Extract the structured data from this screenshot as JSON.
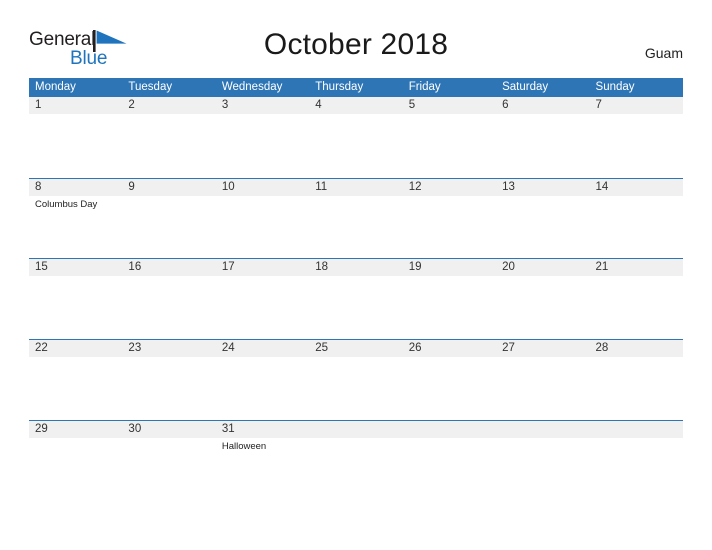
{
  "brand": {
    "name_part1": "General",
    "name_part2": "Blue",
    "flag_icon": "blue-flag-triangle",
    "color_dark": "#231f20",
    "color_blue": "#1f74bd"
  },
  "header": {
    "title": "October 2018",
    "region": "Guam"
  },
  "theme": {
    "header_bg": "#2e75b6",
    "date_band_bg": "#f0f0f0",
    "rule_color": "#2e75b6",
    "page_bg": "#ffffff"
  },
  "calendar": {
    "weekdays": [
      "Monday",
      "Tuesday",
      "Wednesday",
      "Thursday",
      "Friday",
      "Saturday",
      "Sunday"
    ],
    "weeks": [
      {
        "days": [
          {
            "date": "1",
            "events": []
          },
          {
            "date": "2",
            "events": []
          },
          {
            "date": "3",
            "events": []
          },
          {
            "date": "4",
            "events": []
          },
          {
            "date": "5",
            "events": []
          },
          {
            "date": "6",
            "events": []
          },
          {
            "date": "7",
            "events": []
          }
        ]
      },
      {
        "days": [
          {
            "date": "8",
            "events": [
              "Columbus Day"
            ]
          },
          {
            "date": "9",
            "events": []
          },
          {
            "date": "10",
            "events": []
          },
          {
            "date": "11",
            "events": []
          },
          {
            "date": "12",
            "events": []
          },
          {
            "date": "13",
            "events": []
          },
          {
            "date": "14",
            "events": []
          }
        ]
      },
      {
        "days": [
          {
            "date": "15",
            "events": []
          },
          {
            "date": "16",
            "events": []
          },
          {
            "date": "17",
            "events": []
          },
          {
            "date": "18",
            "events": []
          },
          {
            "date": "19",
            "events": []
          },
          {
            "date": "20",
            "events": []
          },
          {
            "date": "21",
            "events": []
          }
        ]
      },
      {
        "days": [
          {
            "date": "22",
            "events": []
          },
          {
            "date": "23",
            "events": []
          },
          {
            "date": "24",
            "events": []
          },
          {
            "date": "25",
            "events": []
          },
          {
            "date": "26",
            "events": []
          },
          {
            "date": "27",
            "events": []
          },
          {
            "date": "28",
            "events": []
          }
        ]
      },
      {
        "days": [
          {
            "date": "29",
            "events": []
          },
          {
            "date": "30",
            "events": []
          },
          {
            "date": "31",
            "events": [
              "Halloween"
            ]
          },
          {
            "date": "",
            "events": []
          },
          {
            "date": "",
            "events": []
          },
          {
            "date": "",
            "events": []
          },
          {
            "date": "",
            "events": []
          }
        ]
      }
    ]
  }
}
